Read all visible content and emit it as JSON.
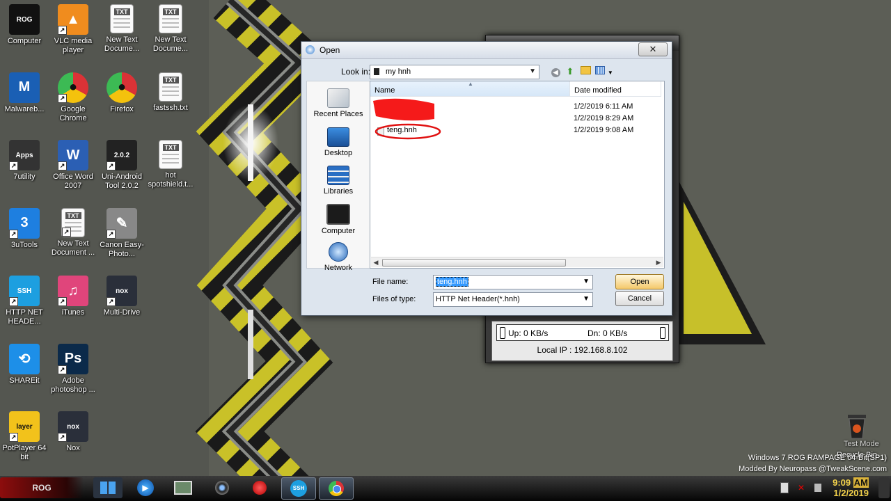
{
  "desktop": {
    "icons": [
      {
        "label": "Computer",
        "glyph": "ROG"
      },
      {
        "label": "VLC media player",
        "glyph": "▲"
      },
      {
        "label": "New Text Docume...",
        "glyph": "TXT"
      },
      {
        "label": "New Text Docume...",
        "glyph": "TXT"
      },
      {
        "label": "Malwareb...",
        "glyph": "M"
      },
      {
        "label": "Google Chrome",
        "glyph": "●"
      },
      {
        "label": "Firefox",
        "glyph": "●"
      },
      {
        "label": "fastssh.txt",
        "glyph": "TXT"
      },
      {
        "label": "7utility",
        "glyph": "Apps"
      },
      {
        "label": "Office Word 2007",
        "glyph": "W"
      },
      {
        "label": "Uni-Android Tool 2.0.2",
        "glyph": "2.0.2"
      },
      {
        "label": "hot spotshield.t...",
        "glyph": "TXT"
      },
      {
        "label": "3uTools",
        "glyph": "3"
      },
      {
        "label": "New Text Document ...",
        "glyph": "TXT"
      },
      {
        "label": "Canon Easy-Photo...",
        "glyph": "✎"
      },
      {
        "label": "HTTP NET HEADE...",
        "glyph": "SSH"
      },
      {
        "label": "iTunes",
        "glyph": "♫"
      },
      {
        "label": "Multi-Drive",
        "glyph": "nox"
      },
      {
        "label": "SHAREit",
        "glyph": "⟲"
      },
      {
        "label": "Adobe photoshop ...",
        "glyph": "Ps"
      },
      {
        "label": "PotPlayer 64 bit",
        "glyph": "layer"
      },
      {
        "label": "Nox",
        "glyph": "nox"
      }
    ],
    "recycle_bin": {
      "label": "Recycle Bin",
      "overlay": "Test Mode"
    },
    "os_info": {
      "line1": "Windows 7 ROG RAMPAGE 64-Bit(SP1)",
      "line2": "Modded By Neuropass @TweakScene.com"
    }
  },
  "speed_widget": {
    "up": "Up: 0 KB/s",
    "down": "Dn: 0 KB/s",
    "local_ip": "Local IP : 192.168.8.102"
  },
  "dialog": {
    "title": "Open",
    "close_label": "✕",
    "look_in_label": "Look in:",
    "look_in_value": "my hnh",
    "places": [
      "Recent Places",
      "Desktop",
      "Libraries",
      "Computer",
      "Network"
    ],
    "columns": {
      "name": "Name",
      "date": "Date modified"
    },
    "files": [
      {
        "name": "",
        "date": "1/2/2019 6:11 AM"
      },
      {
        "name": "",
        "date": "1/2/2019 8:29 AM"
      },
      {
        "name": "teng.hnh",
        "date": "1/2/2019 9:08 AM"
      }
    ],
    "file_name_label": "File name:",
    "file_name_value": "teng.hnh",
    "file_type_label": "Files of type:",
    "file_type_value": "HTTP Net Header(*.hnh)",
    "open_button": "Open",
    "cancel_button": "Cancel"
  },
  "taskbar": {
    "time": "9:09",
    "ampm": "AM",
    "date": "1/2/2019"
  },
  "colors": {
    "accent_red": "#b80d0d",
    "clock_gold": "#f3d24b",
    "selection_blue": "#3399ff"
  }
}
